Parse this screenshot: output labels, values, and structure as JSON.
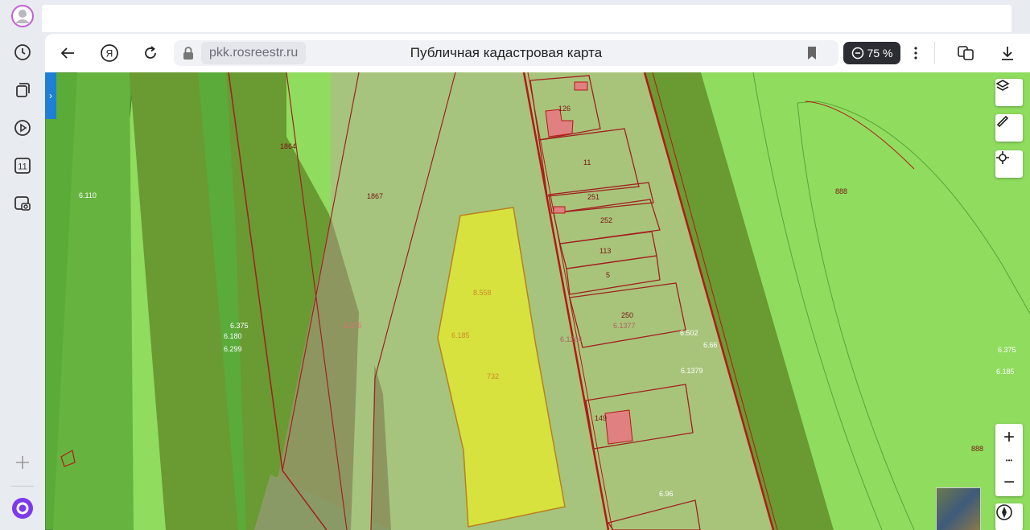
{
  "browser": {
    "url": "pkk.rosreestr.ru",
    "page_title": "Публичная кадастровая карта",
    "zoom": "75 %",
    "sidebar_badge": "11"
  },
  "map": {
    "zoom_in": "+",
    "zoom_more": "•••",
    "zoom_out": "−",
    "panel_toggle": "›",
    "labels": {
      "l1864": "1864",
      "l6110": "6.110",
      "l1867": "1867",
      "l126": "126",
      "l11": "11",
      "l251": "251",
      "l252": "252",
      "l113": "113",
      "l5": "5",
      "l8558": "8.558",
      "l6185a": "6.185",
      "l732": "732",
      "l6375a": "6.375",
      "l6180": "6.180",
      "l6299": "6.299",
      "l6375b": "6.375",
      "l250": "250",
      "l61377": "6.1377",
      "l61204": "6.1204",
      "l6502": "6.502",
      "l666": "6.66",
      "l61379": "6.1379",
      "l149": "149",
      "l696": "6.96",
      "l888a": "888",
      "l888b": "888",
      "l6375c": "6.375",
      "l6185b": "6.185"
    }
  }
}
